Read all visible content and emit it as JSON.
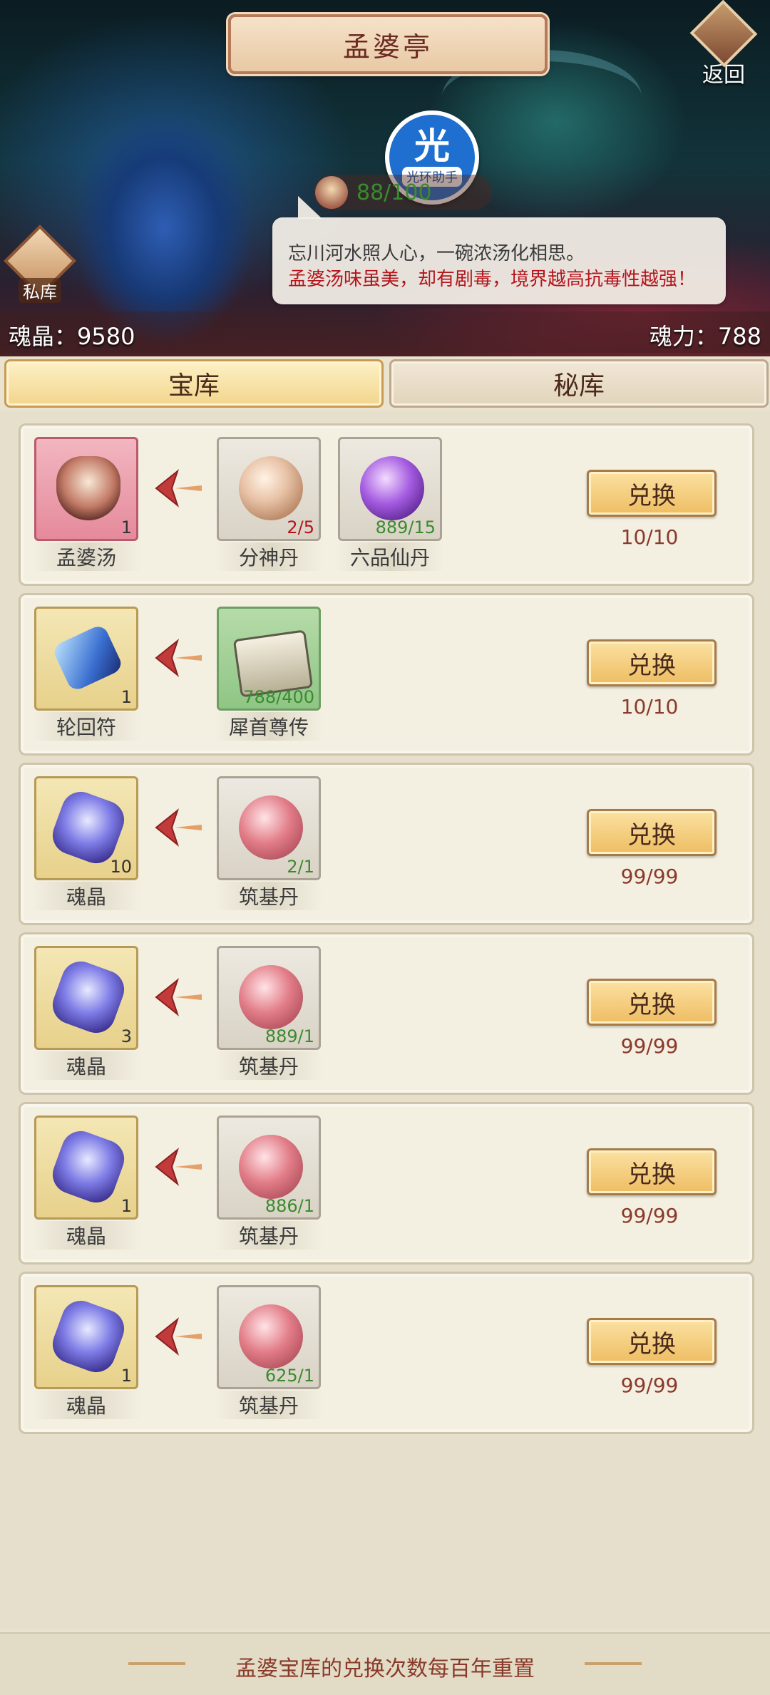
{
  "header": {
    "title": "孟婆亭",
    "back_label": "返回",
    "private_label": "私库",
    "helper": {
      "glyph": "光",
      "label": "光环助手"
    },
    "progress": "88/100",
    "speech": {
      "line1": "忘川河水照人心，一碗浓汤化相思。",
      "line2": "孟婆汤味虽美，却有剧毒，境界越高抗毒性越强！"
    },
    "soul_crystal": "魂晶：9580",
    "soul_power": "魂力：788"
  },
  "tabs": [
    {
      "label": "宝库",
      "active": true
    },
    {
      "label": "秘库",
      "active": false
    }
  ],
  "exchange_button_label": "兑换",
  "rows": [
    {
      "reward": {
        "name": "孟婆汤",
        "count": "1",
        "icon": "soup-icon"
      },
      "costs": [
        {
          "name": "分神丹",
          "count": "2/5",
          "count_color": "red",
          "icon": "tan-pill-icon"
        },
        {
          "name": "六品仙丹",
          "count": "889/15",
          "count_color": "green",
          "icon": "purple-orb-icon"
        }
      ],
      "limit": "10/10"
    },
    {
      "reward": {
        "name": "轮回符",
        "count": "1",
        "icon": "talisman-icon"
      },
      "costs": [
        {
          "name": "犀首尊传",
          "count": "788/400",
          "count_color": "green",
          "icon": "book-icon"
        }
      ],
      "limit": "10/10"
    },
    {
      "reward": {
        "name": "魂晶",
        "count": "10",
        "icon": "soul-crystal-icon"
      },
      "costs": [
        {
          "name": "筑基丹",
          "count": "2/1",
          "count_color": "green",
          "icon": "red-pill-icon"
        }
      ],
      "limit": "99/99"
    },
    {
      "reward": {
        "name": "魂晶",
        "count": "3",
        "icon": "soul-crystal-icon"
      },
      "costs": [
        {
          "name": "筑基丹",
          "count": "889/1",
          "count_color": "green",
          "icon": "red-pill-icon"
        }
      ],
      "limit": "99/99"
    },
    {
      "reward": {
        "name": "魂晶",
        "count": "1",
        "icon": "soul-crystal-icon"
      },
      "costs": [
        {
          "name": "筑基丹",
          "count": "886/1",
          "count_color": "green",
          "icon": "red-pill-icon"
        }
      ],
      "limit": "99/99"
    },
    {
      "reward": {
        "name": "魂晶",
        "count": "1",
        "icon": "soul-crystal-icon"
      },
      "costs": [
        {
          "name": "筑基丹",
          "count": "625/1",
          "count_color": "green",
          "icon": "red-pill-icon"
        }
      ],
      "limit": "99/99"
    }
  ],
  "footer_note": "孟婆宝库的兑换次数每百年重置"
}
